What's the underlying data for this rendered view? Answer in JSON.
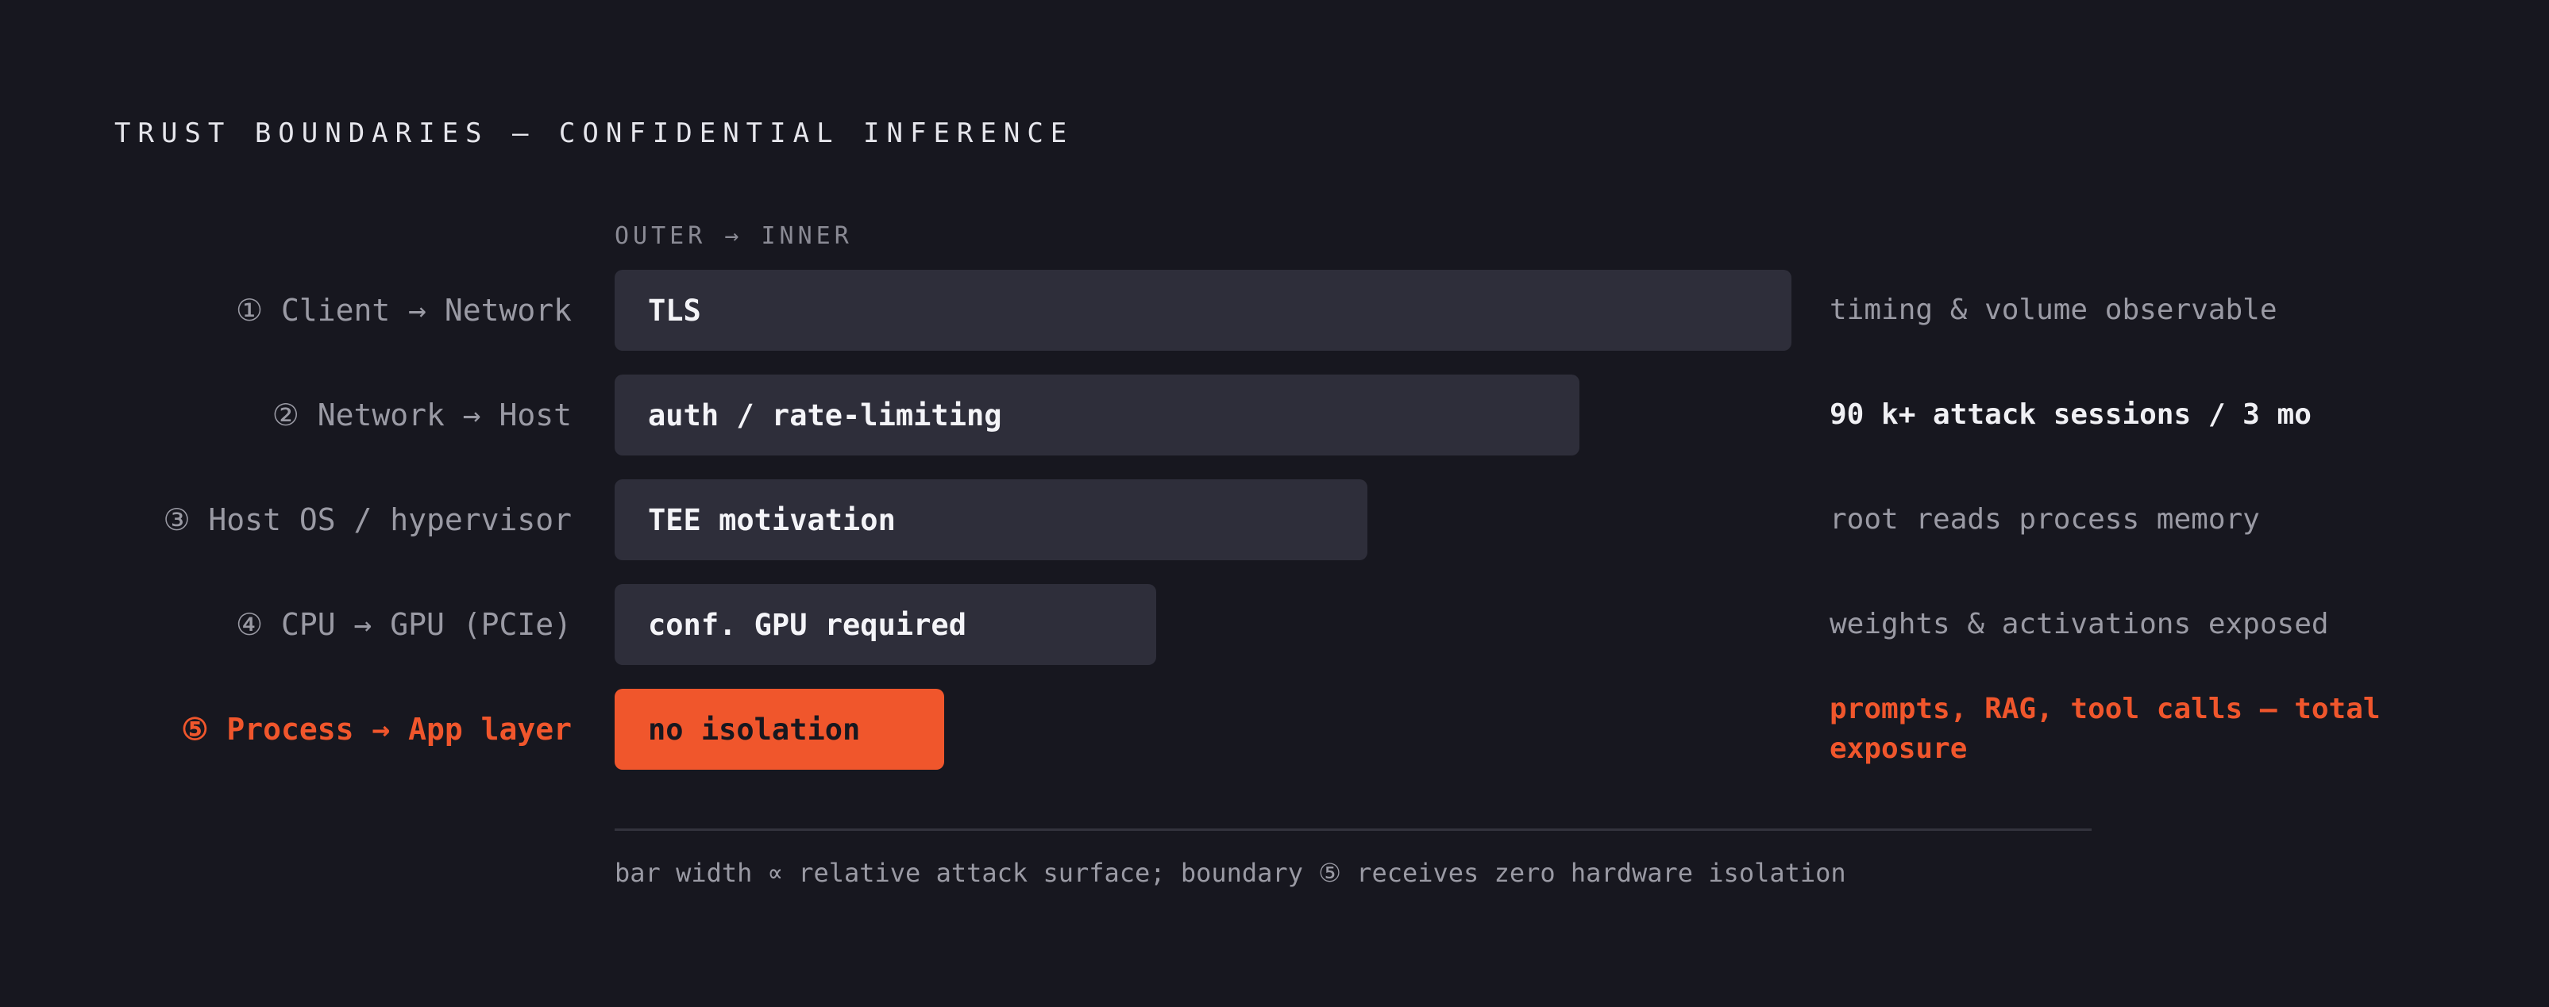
{
  "title": "TRUST BOUNDARIES — CONFIDENTIAL INFERENCE",
  "column_header": "OUTER → INNER",
  "rows": [
    {
      "label": "① Client → Network",
      "bar_text": "TLS",
      "attack_surface": 1.0,
      "note": "timing & volume observable",
      "highlight": false
    },
    {
      "label": "② Network → Host",
      "bar_text": "auth / rate-limiting",
      "attack_surface": 0.82,
      "note": "90 k+ attack sessions / 3 mo",
      "highlight": false
    },
    {
      "label": "③ Host OS / hypervisor",
      "bar_text": "TEE motivation",
      "attack_surface": 0.64,
      "note": "root reads process memory",
      "highlight": false
    },
    {
      "label": "④ CPU → GPU (PCIe)",
      "bar_text": "conf. GPU required",
      "attack_surface": 0.46,
      "note": "weights & activations exposed",
      "highlight": false
    },
    {
      "label": "⑤ Process → App layer",
      "bar_text": "no isolation",
      "attack_surface": 0.28,
      "note": "prompts, RAG, tool calls — total exposure",
      "highlight": true
    }
  ],
  "footnote": "bar width ∝ relative attack surface; boundary ⑤ receives zero hardware isolation",
  "colors": {
    "background": "#17171f",
    "bar": "#2e2e3a",
    "accent": "#f0562c"
  }
}
